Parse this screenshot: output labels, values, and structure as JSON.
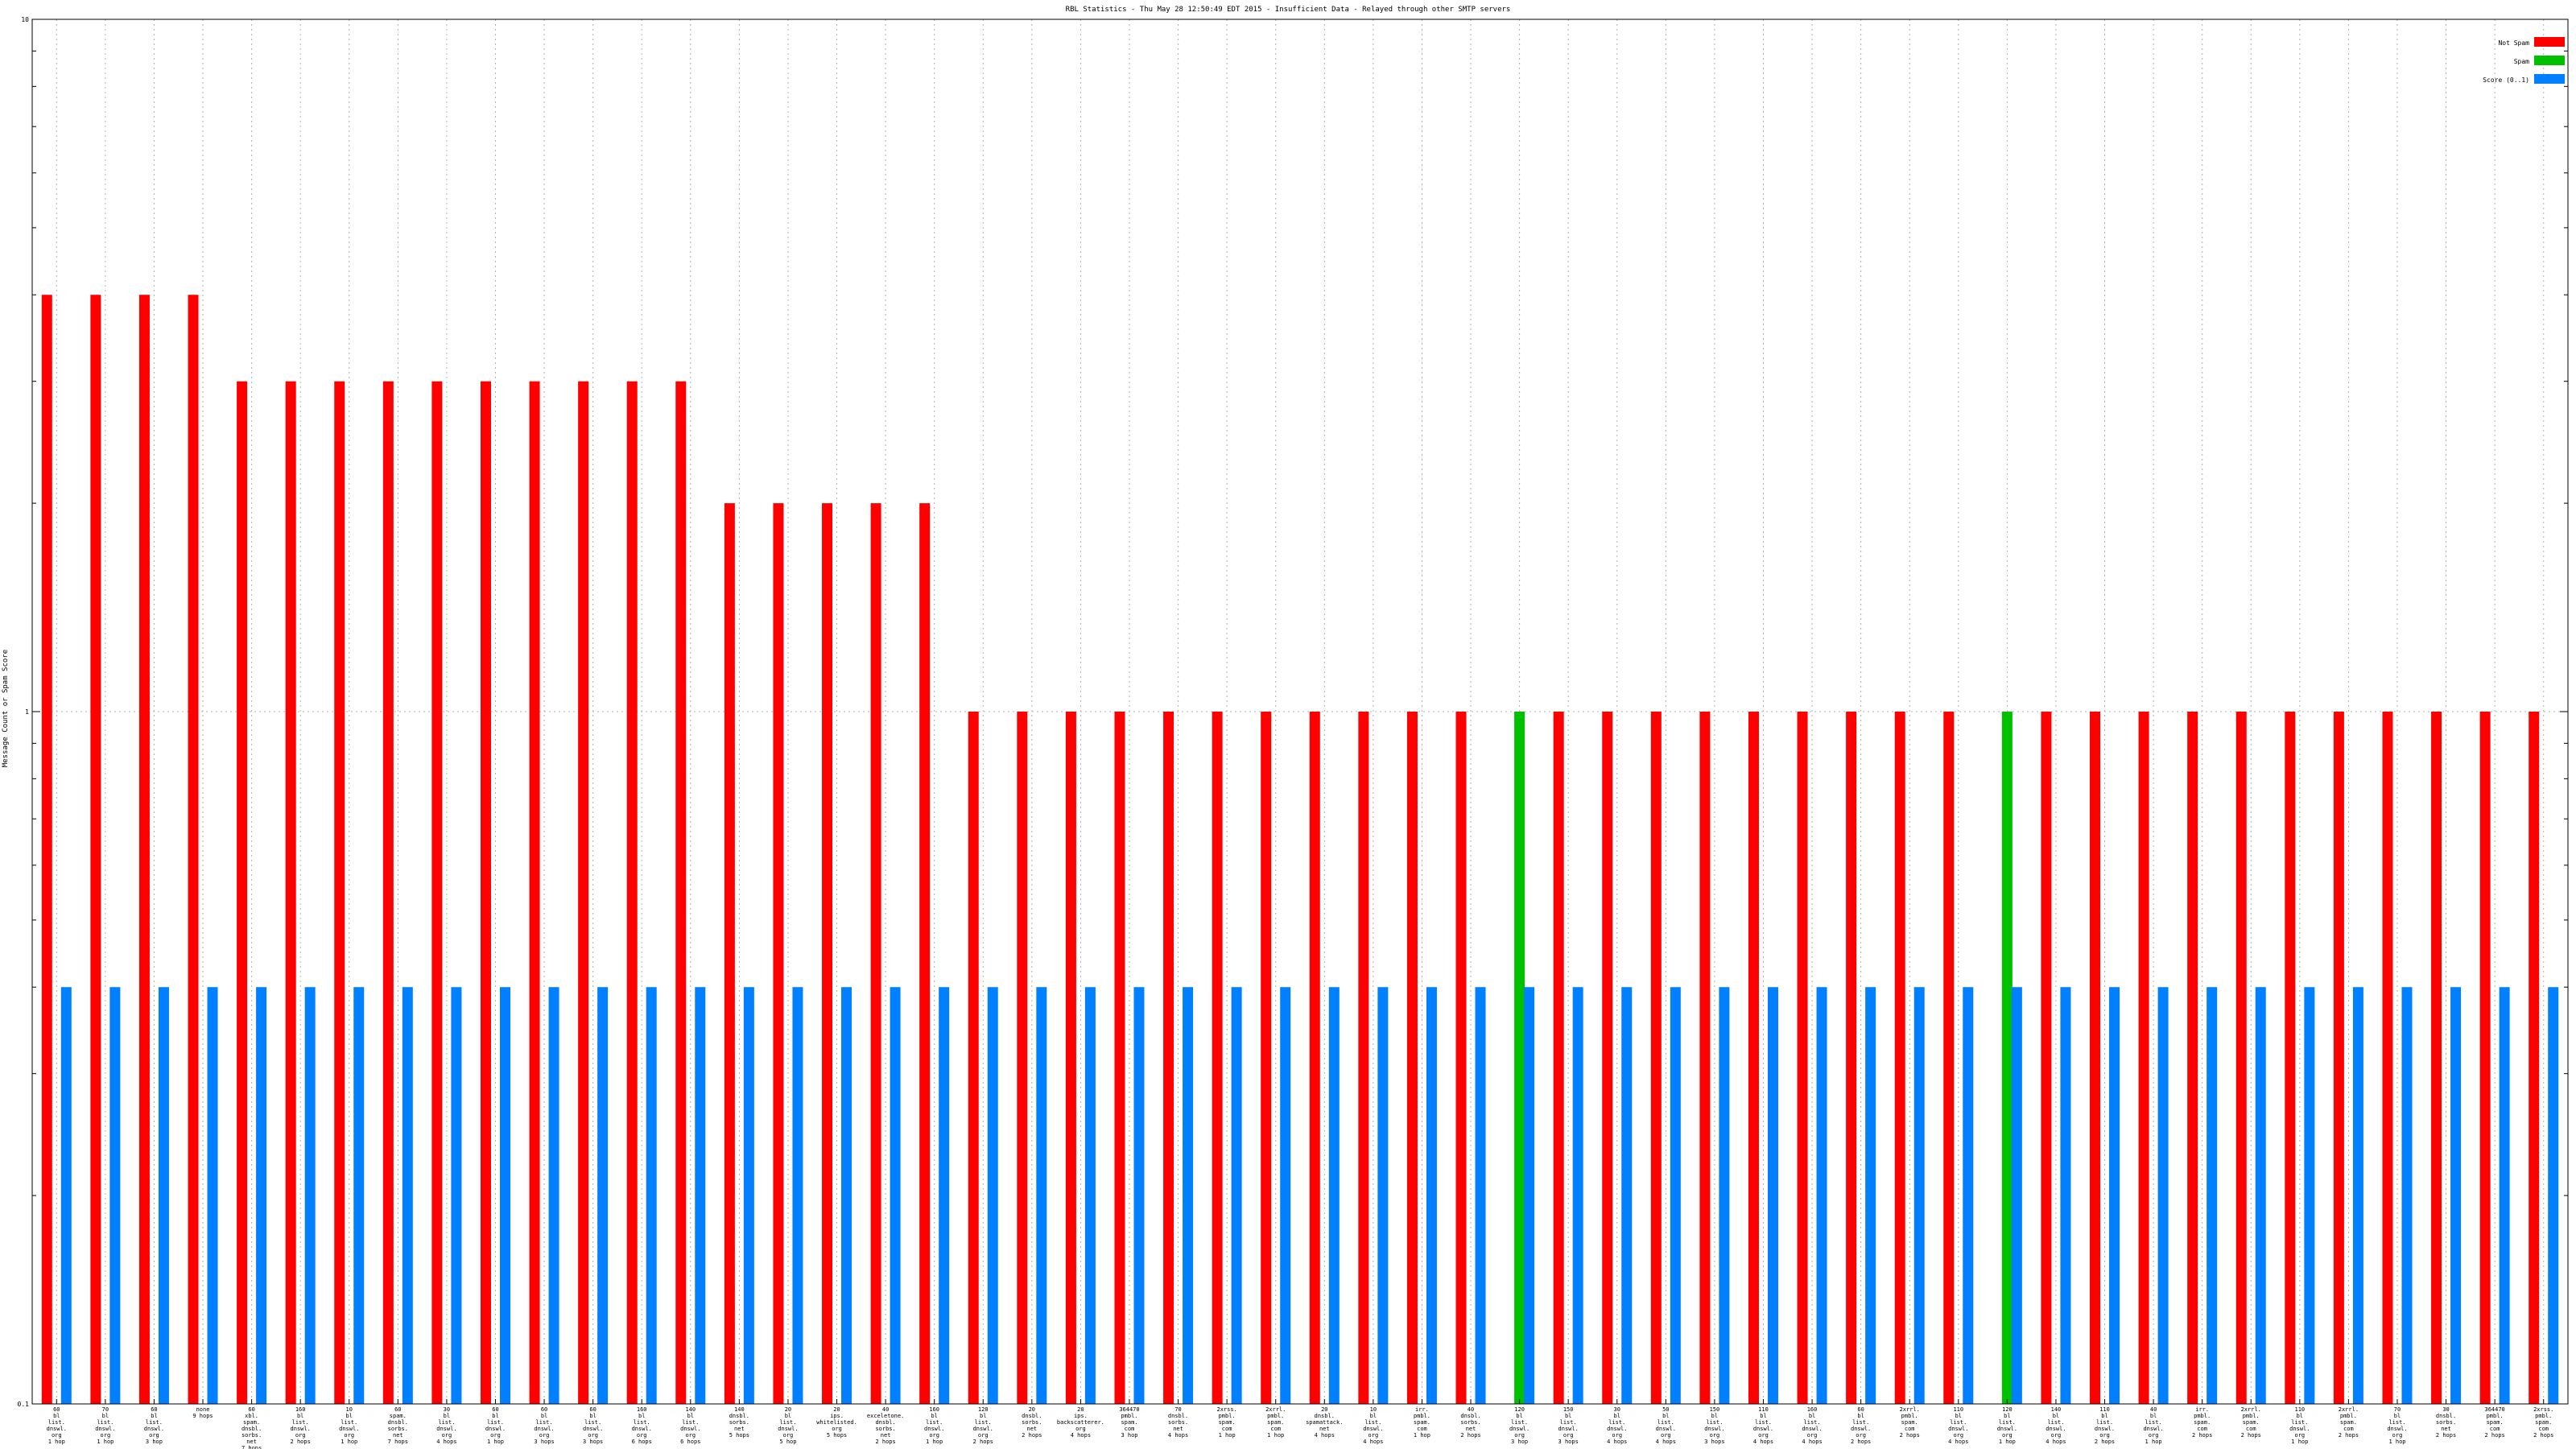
{
  "chart_data": {
    "type": "bar",
    "title": "RBL Statistics - Thu May 28 12:50:49 EDT 2015 - Insufficient Data - Relayed through other SMTP servers",
    "xlabel": "",
    "ylabel": "Message Count or Spam Score",
    "y_scale": "log",
    "ylim": [
      0.1,
      10
    ],
    "y_ticks": [
      {
        "value": 10,
        "label": "10"
      },
      {
        "value": 1,
        "label": "1"
      },
      {
        "value": 0.1,
        "label": "0.1"
      }
    ],
    "grid": true,
    "legend_position": "top-right",
    "colors": {
      "not_spam": "#ff0000",
      "spam": "#00c000",
      "score": "#0080ff"
    },
    "categories": [
      "60|bl|list.|dnswl.|org|1 hop",
      "70|bl|list.|dnswl.|org|1 hop",
      "60|bl|list.|dnswl.|org|3 hop",
      "none|9 hops",
      "60|xbl.|spam.|dnsbl.|sorbs.|net|7 hops",
      "160|bl|list.|dnswl.|org|2 hops",
      "10|bl|list.|dnswl.|org|1 hop",
      "60|spam.|dnsbl.|sorbs.|net|7 hops",
      "30|bl|list.|dnswl.|org|4 hops",
      "60|bl|list.|dnswl.|org|1 hop",
      "60|bl|list.|dnswl.|org|3 hops",
      "60|bl|list.|dnswl.|org|3 hops",
      "160|bl|list.|dnswl.|org|6 hops",
      "140|bl|list.|dnswl.|org|6 hops",
      "140|dnsbl.|sorbs.|net|5 hops",
      "20|bl|list.|dnswl.|org|5 hop",
      "20|ips.|whitelisted.|org|5 hops",
      "40|exceletone.|dnsbl.|sorbs.|net|2 hops",
      "160|bl|list.|dnswl.|org|1 hop",
      "120|bl|list.|dnswl.|org|2 hops",
      "20|dnsbl.|sorbs.|net|2 hops",
      "20|ips.|backscatterer.|org|4 hops",
      "364470|pmbl.|spam.|com|3 hop",
      "70|dnsbl.|sorbs.|net|4 hops",
      "2xrss.|pmbl.|spam.|com|1 hop",
      "2xrrl.|pmbl.|spam.|com|1 hop",
      "20|dnsbl.|spamattack.|net|4 hops",
      "10|bl|list.|dnswl.|org|4 hops",
      "irr.|pmbl.|spam.|com|1 hop",
      "40|dnsbl.|sorbs.|net|2 hops",
      "120|bl|list.|dnswl.|org|3 hop",
      "150|bl|list.|dnswl.|org|3 hops",
      "30|bl|list.|dnswl.|org|4 hops",
      "50|bl|list.|dnswl.|org|4 hops",
      "150|bl|list.|dnswl.|org|3 hops",
      "110|bl|list.|dnswl.|org|4 hops",
      "160|bl|list.|dnswl.|org|4 hops",
      "60|bl|list.|dnswl.|org|2 hops",
      "2xrrl.|pmbl.|spam.|com|2 hops",
      "110|bl|list.|dnswl.|org|4 hops",
      "120|bl|list.|dnswl.|org|1 hop",
      "140|bl|list.|dnswl.|org|4 hops",
      "110|bl|list.|dnswl.|org|2 hops",
      "40|bl|list.|dnswl.|org|1 hop",
      "irr.|pmbl.|spam.|com|2 hops",
      "2xrrl.|pmbl.|spam.|com|2 hops",
      "110|bl|list.|dnswl.|org|1 hop",
      "2xrrl.|pmbl.|spam.|com|2 hops",
      "70|bl|list.|dnswl.|org|1 hop",
      "30|dnsbl.|sorbs.|net|2 hops",
      "364470|pmbl.|spam.|com|2 hops",
      "2xrss.|pmbl.|spam.|com|2 hops"
    ],
    "series": [
      {
        "name": "Not Spam",
        "color": "#ff0000",
        "values": [
          4,
          4,
          4,
          4,
          3,
          3,
          3,
          3,
          3,
          3,
          3,
          3,
          3,
          3,
          2,
          2,
          2,
          2,
          2,
          1,
          1,
          1,
          1,
          1,
          1,
          1,
          1,
          1,
          1,
          1,
          0,
          1,
          1,
          1,
          1,
          1,
          1,
          1,
          1,
          1,
          0,
          1,
          1,
          1,
          1,
          1,
          1,
          1,
          1,
          1,
          1,
          1
        ]
      },
      {
        "name": "Spam",
        "color": "#00c000",
        "values": [
          0,
          0,
          0,
          0,
          0,
          0,
          0,
          0,
          0,
          0,
          0,
          0,
          0,
          0,
          0,
          0,
          0,
          0,
          0,
          0,
          0,
          0,
          0,
          0,
          0,
          0,
          0,
          0,
          0,
          0,
          1,
          0,
          0,
          0,
          0,
          0,
          0,
          0,
          0,
          0,
          1,
          0,
          0,
          0,
          0,
          0,
          0,
          0,
          0,
          0,
          0,
          0
        ]
      },
      {
        "name": "Score (0..1)",
        "color": "#0080ff",
        "values": [
          0.4,
          0.4,
          0.4,
          0.4,
          0.4,
          0.4,
          0.4,
          0.4,
          0.4,
          0.4,
          0.4,
          0.4,
          0.4,
          0.4,
          0.4,
          0.4,
          0.4,
          0.4,
          0.4,
          0.4,
          0.4,
          0.4,
          0.4,
          0.4,
          0.4,
          0.4,
          0.4,
          0.4,
          0.4,
          0.4,
          0.4,
          0.4,
          0.4,
          0.4,
          0.4,
          0.4,
          0.4,
          0.4,
          0.4,
          0.4,
          0.4,
          0.4,
          0.4,
          0.4,
          0.4,
          0.4,
          0.4,
          0.4,
          0.4,
          0.4,
          0.4,
          0.4
        ]
      }
    ]
  }
}
